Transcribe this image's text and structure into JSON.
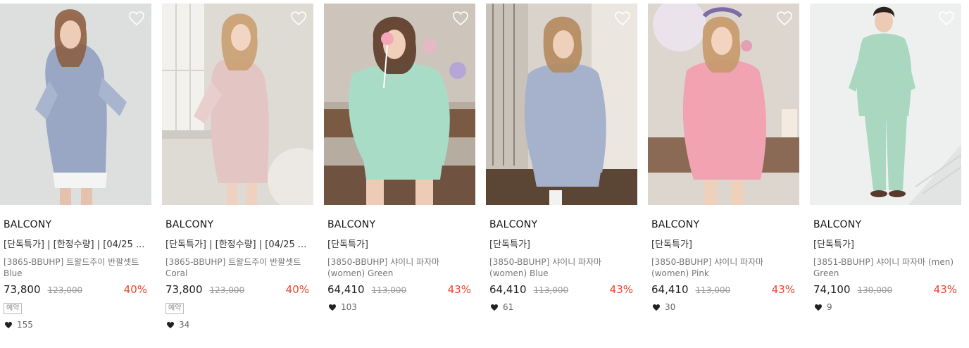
{
  "colors": {
    "discount": "#e8492f",
    "heart_outline": "#ffffff",
    "like_heart": "#222222"
  },
  "products": [
    {
      "brand": "BALCONY",
      "tags": "[단독특가] | [한정수량] | [04/25 ...",
      "name": "[3865-BBUHP] 트왈드주이 반팔셋트 Blue",
      "price": "73,800",
      "original_price": "123,000",
      "discount": "40%",
      "badge": "예약",
      "likes": "155",
      "icon": "heart-outline-icon"
    },
    {
      "brand": "BALCONY",
      "tags": "[단독특가] | [한정수량] | [04/25 ...",
      "name": "[3865-BBUHP] 트왈드주이 반팔셋트 Coral",
      "price": "73,800",
      "original_price": "123,000",
      "discount": "40%",
      "badge": "예약",
      "likes": "34",
      "icon": "heart-outline-icon"
    },
    {
      "brand": "BALCONY",
      "tags": "[단독특가]",
      "name": "[3850-BBUHP] 샤이니 파자마 (women) Green",
      "price": "64,410",
      "original_price": "113,000",
      "discount": "43%",
      "badge": "",
      "likes": "103",
      "icon": "heart-outline-icon"
    },
    {
      "brand": "BALCONY",
      "tags": "[단독특가]",
      "name": "[3850-BBUHP] 샤이니 파자마 (women) Blue",
      "price": "64,410",
      "original_price": "113,000",
      "discount": "43%",
      "badge": "",
      "likes": "61",
      "icon": "heart-outline-icon"
    },
    {
      "brand": "BALCONY",
      "tags": "[단독특가]",
      "name": "[3850-BBUHP] 샤이니 파자마 (women) Pink",
      "price": "64,410",
      "original_price": "113,000",
      "discount": "43%",
      "badge": "",
      "likes": "30",
      "icon": "heart-outline-icon"
    },
    {
      "brand": "BALCONY",
      "tags": "[단독특가]",
      "name": "[3851-BBUHP] 샤이니 파자마 (men) Green",
      "price": "74,100",
      "original_price": "130,000",
      "discount": "43%",
      "badge": "",
      "likes": "9",
      "icon": "heart-outline-icon"
    }
  ]
}
